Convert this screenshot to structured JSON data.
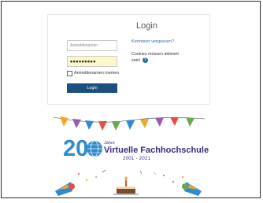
{
  "login": {
    "title": "Login",
    "username_placeholder": "Anmeldenamen",
    "password_value": "•••••••••",
    "forgot_link": "Kennwort vergessen?",
    "cookie_note": "Cookies müssen aktiviert sein!",
    "remember_label": "Anmeldenamen merken",
    "login_button": "Login",
    "help_icon": "?"
  },
  "banner": {
    "number": "20",
    "jahre": "Jahre",
    "title": "Virtuelle Fachhochschule",
    "years": "2001 - 2021",
    "image_description": "Celebration illustration with colorful bunting flags, confetti, two party poppers and a birthday cake with a candle"
  },
  "colors": {
    "link": "#2b6aa8",
    "button": "#1a4f80",
    "password_bg": "#fcf8c7",
    "brand_blue": "#2f8bcf",
    "brand_purple": "#3a2a80"
  }
}
